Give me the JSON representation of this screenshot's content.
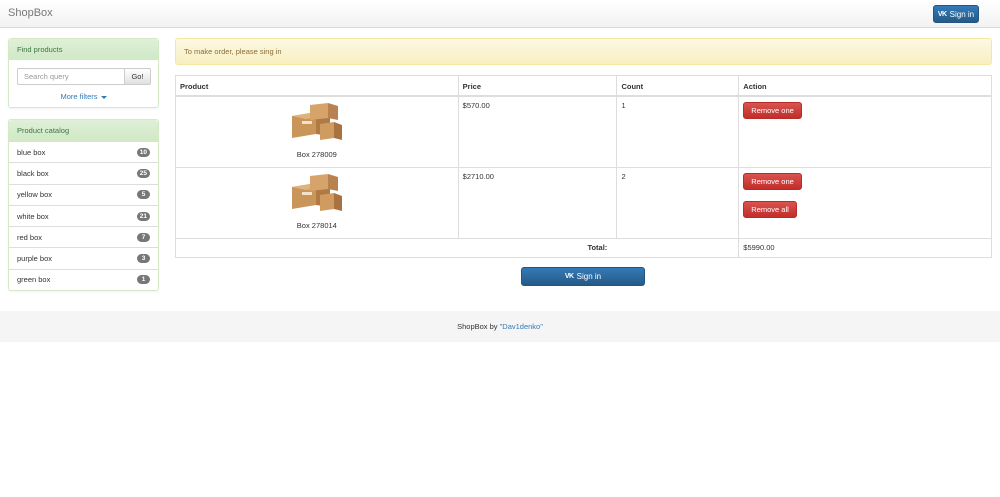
{
  "navbar": {
    "brand": "ShopBox",
    "signin_label": "Sign in",
    "vk_icon_text": "VK"
  },
  "find_panel": {
    "title": "Find products",
    "search_placeholder": "Search query",
    "go_label": "Go!",
    "more_filters_label": "More filters"
  },
  "catalog": {
    "title": "Product catalog",
    "items": [
      {
        "label": "blue box",
        "count": "10"
      },
      {
        "label": "black box",
        "count": "25"
      },
      {
        "label": "yellow box",
        "count": "5"
      },
      {
        "label": "white box",
        "count": "21"
      },
      {
        "label": "red box",
        "count": "7"
      },
      {
        "label": "purple box",
        "count": "3"
      },
      {
        "label": "green box",
        "count": "1"
      }
    ]
  },
  "alert": {
    "text": "To make order, please sing in"
  },
  "cart": {
    "headers": {
      "product": "Product",
      "price": "Price",
      "count": "Count",
      "action": "Action"
    },
    "rows": [
      {
        "name": "Box 278009",
        "price": "$570.00",
        "count": "1",
        "remove_one": "Remove one"
      },
      {
        "name": "Box 278014",
        "price": "$2710.00",
        "count": "2",
        "remove_one": "Remove one",
        "remove_all": "Remove all"
      }
    ],
    "total_label": "Total:",
    "total_value": "$5990.00"
  },
  "main_signin_label": "Sign in",
  "footer": {
    "prefix": "ShopBox by ",
    "author": "\"Dav1denko\""
  },
  "colors": {
    "primary": "#337ab7",
    "danger": "#d9534f",
    "success_heading": "#dff0d8",
    "warning_bg": "#fcf8e3",
    "badge": "#777777"
  }
}
